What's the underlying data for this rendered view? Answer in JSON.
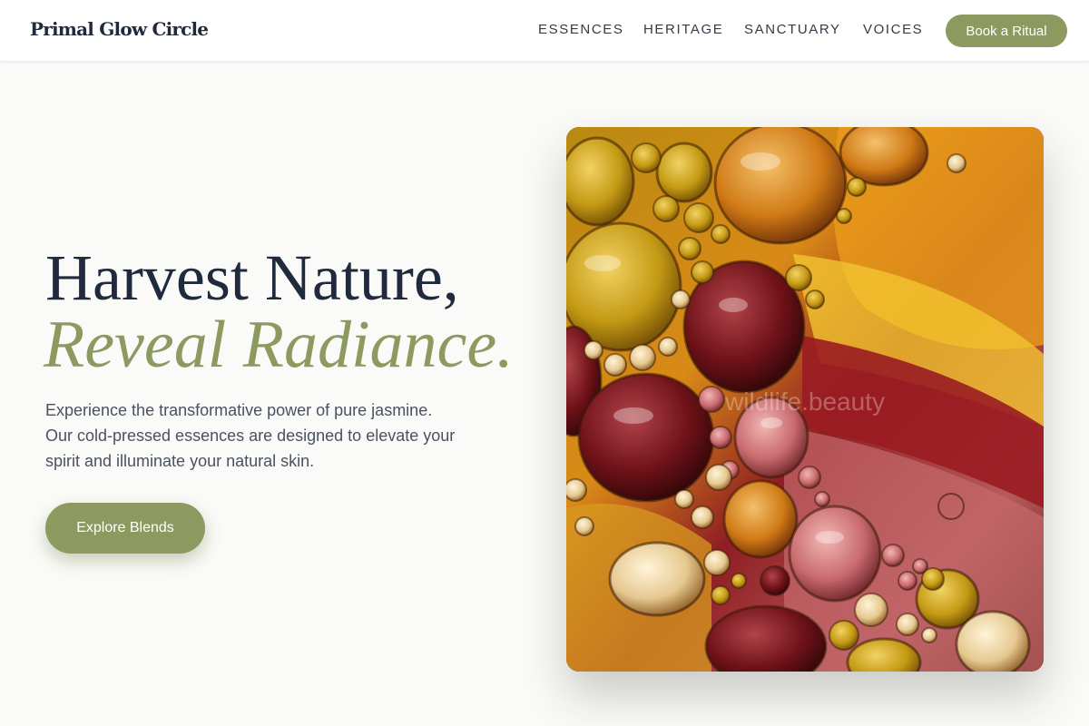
{
  "brand": {
    "name": "Primal Glow Circle"
  },
  "nav": {
    "items": [
      {
        "label": "ESSENCES"
      },
      {
        "label": "HERITAGE"
      },
      {
        "label": "SANCTUARY"
      },
      {
        "label": "VOICES"
      }
    ],
    "cta_label": "Book a Ritual"
  },
  "hero": {
    "title": "Harvest Nature,",
    "accent": "Reveal Radiance.",
    "description": "Experience the transformative power of pure jasmine. Our cold-pressed essences are designed to elevate your spirit and illuminate your natural skin.",
    "cta_label": "Explore Blends",
    "image": {
      "subject": "macro of oil bubbles in amber, gold and crimson tones",
      "watermark": "wildlife.beauty"
    }
  },
  "colors": {
    "accent": "#8c9a5f",
    "heading": "#1f2a3c",
    "body_text": "#4a5261",
    "background": "#fafaf8"
  }
}
